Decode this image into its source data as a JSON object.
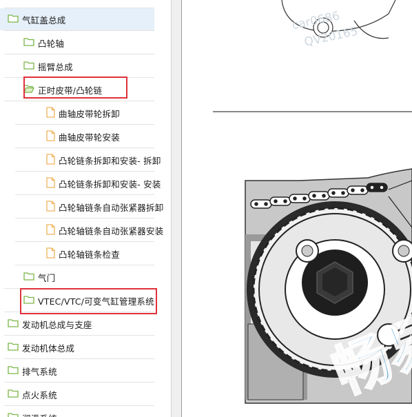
{
  "tree": {
    "items": [
      {
        "label": "气缸盖总成",
        "level": 0,
        "type": "folder",
        "selected": true
      },
      {
        "label": "凸轮轴",
        "level": 1,
        "type": "folder"
      },
      {
        "label": "摇臂总成",
        "level": 1,
        "type": "folder"
      },
      {
        "label": "正时皮带/凸轮链",
        "level": 1,
        "type": "folder-open"
      },
      {
        "label": "曲轴皮带轮拆卸",
        "level": 2,
        "type": "doc"
      },
      {
        "label": "曲轴皮带轮安装",
        "level": 2,
        "type": "doc"
      },
      {
        "label": "凸轮链条拆卸和安装- 拆卸",
        "level": 2,
        "type": "doc"
      },
      {
        "label": "凸轮链条拆卸和安装- 安装",
        "level": 2,
        "type": "doc"
      },
      {
        "label": "凸轮轴链条自动张紧器拆卸",
        "level": 2,
        "type": "doc"
      },
      {
        "label": "凸轮轴链条自动张紧器安装",
        "level": 2,
        "type": "doc"
      },
      {
        "label": "凸轮轴链条检查",
        "level": 2,
        "type": "doc"
      },
      {
        "label": "气门",
        "level": 1,
        "type": "folder"
      },
      {
        "label": "VTEC/VTC/可变气缸管理系统",
        "level": 1,
        "type": "folder"
      },
      {
        "label": "发动机总成与支座",
        "level": 0,
        "type": "folder"
      },
      {
        "label": "发动机体总成",
        "level": 0,
        "type": "folder"
      },
      {
        "label": "排气系统",
        "level": 0,
        "type": "folder"
      },
      {
        "label": "点火系统",
        "level": 0,
        "type": "folder"
      },
      {
        "label": "润滑系统",
        "level": 0,
        "type": "folder"
      }
    ]
  },
  "document": {
    "watermark_top": "car0686 QV20165",
    "watermark_big": "畅易"
  },
  "colors": {
    "highlight": "#e0303a",
    "folder": "#7ab648",
    "doc": "#f0b25a",
    "selected_bg": "#e6f0fa",
    "watermark": "#1a88d0"
  }
}
